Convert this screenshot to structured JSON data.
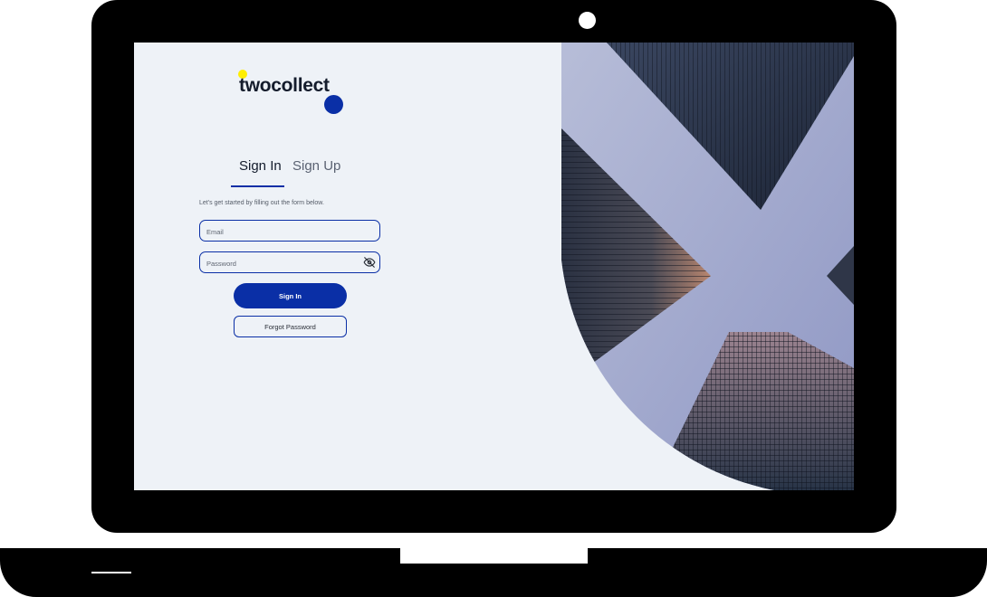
{
  "brand": {
    "name": "twocollect",
    "accent": "#0a2fa6",
    "dot_yellow": "#ffee00"
  },
  "tabs": [
    {
      "label": "Sign In",
      "active": true
    },
    {
      "label": "Sign Up",
      "active": false
    }
  ],
  "form": {
    "subtitle": "Let's get started by filling out the form below.",
    "email_placeholder": "Email",
    "email_value": "",
    "password_placeholder": "Password",
    "password_value": "",
    "password_toggle_icon": "eye-off-icon",
    "signin_label": "Sign In",
    "forgot_label": "Forgot Password"
  },
  "hero": {
    "description_icon": "skyscrapers-photo"
  }
}
